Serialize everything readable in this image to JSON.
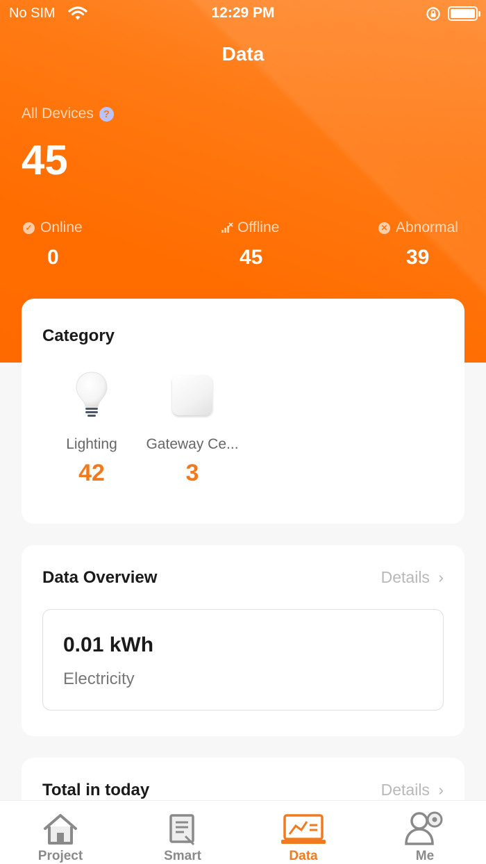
{
  "status_bar": {
    "carrier": "No SIM",
    "time": "12:29 PM"
  },
  "header": {
    "title": "Data"
  },
  "summary": {
    "label": "All Devices",
    "total": "45",
    "online": {
      "label": "Online",
      "value": "0"
    },
    "offline": {
      "label": "Offline",
      "value": "45"
    },
    "abnormal": {
      "label": "Abnormal",
      "value": "39"
    }
  },
  "category": {
    "title": "Category",
    "items": [
      {
        "name": "Lighting",
        "count": "42",
        "icon": "light-bulb-icon"
      },
      {
        "name": "Gateway Ce...",
        "count": "3",
        "icon": "gateway-device-icon"
      }
    ]
  },
  "overview": {
    "title": "Data Overview",
    "details": "Details",
    "electricity_value": "0.01 kWh",
    "electricity_label": "Electricity"
  },
  "today": {
    "title": "Total in today",
    "details": "Details"
  },
  "tabs": [
    {
      "label": "Project",
      "icon": "house-icon"
    },
    {
      "label": "Smart",
      "icon": "document-icon"
    },
    {
      "label": "Data",
      "icon": "monitor-chart-icon",
      "active": true
    },
    {
      "label": "Me",
      "icon": "user-gear-icon"
    }
  ],
  "colors": {
    "accent": "#f07a1f",
    "hero": "#ff7a14"
  }
}
